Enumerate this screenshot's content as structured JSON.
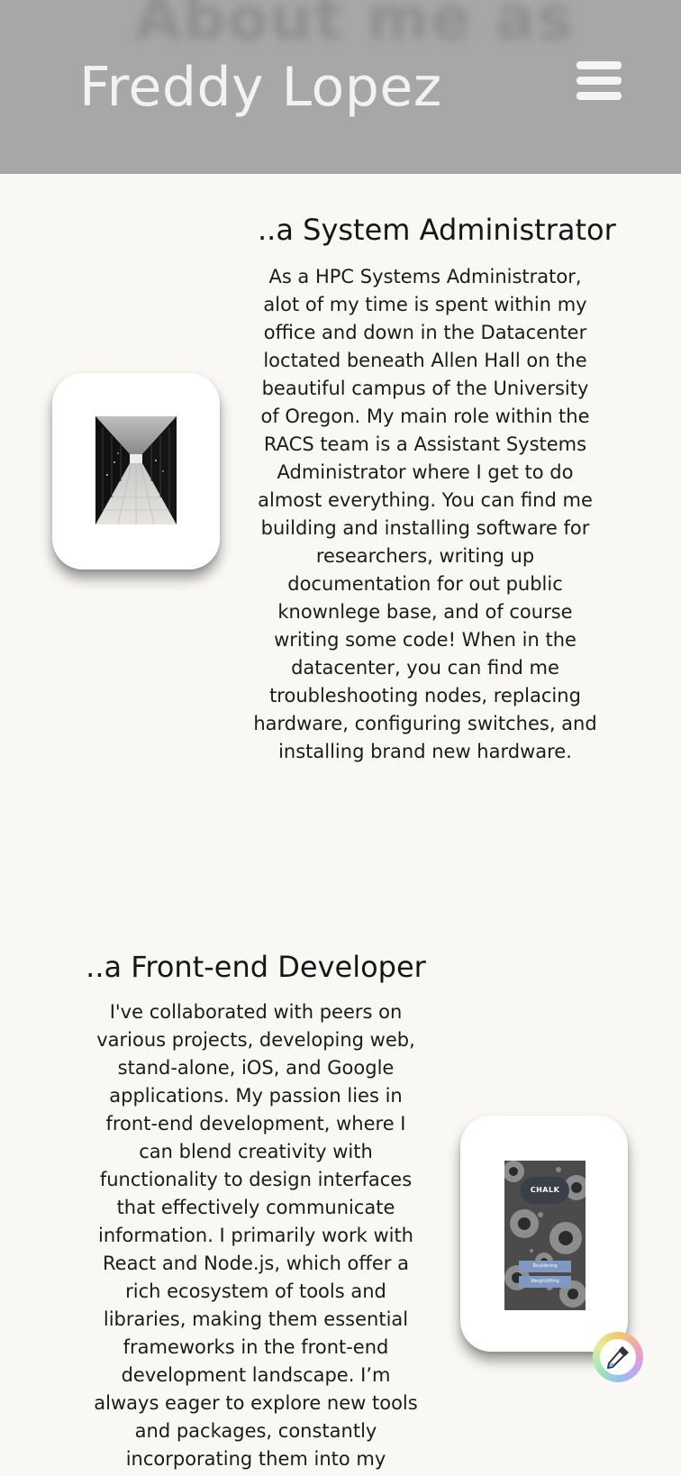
{
  "header": {
    "ghost_title": "About me as",
    "brand": "Freddy Lopez",
    "menu_icon": "hamburger-menu-icon",
    "background": "#a7a7a7"
  },
  "sections": [
    {
      "title": "..a System Administrator",
      "body": "As a HPC Systems Administrator, alot of my time is spent within my office and down in the Datacenter loctated beneath Allen Hall on the beautiful campus of the University of Oregon. My main role within the RACS team is a Assistant Systems Administrator where I get to do almost everything. You can find me building and installing software for researchers, writing up documentation for out public knownlege base, and of course writing some code! When in the datacenter, you can find me troubleshooting nodes, replacing hardware, configuring switches, and installing brand new hardware."
    },
    {
      "title": "..a Front-end Developer",
      "body": "I've collaborated with peers on various projects, developing web, stand-alone, iOS, and Google applications. My passion lies in front-end development, where I can blend creativity with functionality to design interfaces that effectively communicate information. I primarily work with React and Node.js, which offer a rich ecosystem of tools and libraries, making them essential frameworks in the front-end development landscape. I’m always eager to explore new tools and packages, constantly incorporating them into my projects. For me, learning is a lifelong journey, and"
    }
  ],
  "chalk_app": {
    "logo": "CHALK",
    "buttons": [
      "Bouldering",
      "Weightlifting"
    ]
  },
  "floating_button": {
    "icon": "eyedropper-icon"
  },
  "colors": {
    "page_background": "#f9f8f5",
    "text": "#161616",
    "card": "#ffffff"
  }
}
